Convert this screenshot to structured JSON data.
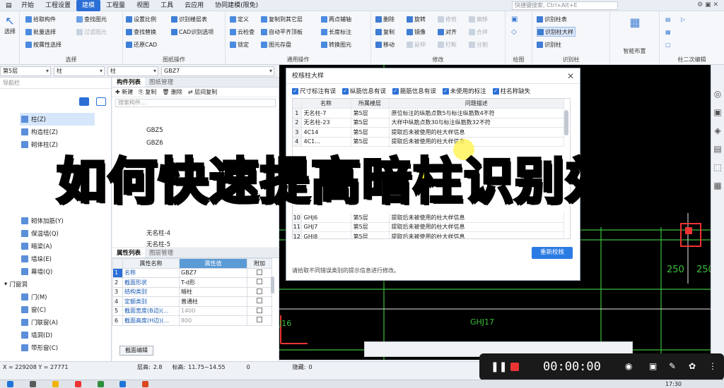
{
  "menubar": {
    "items": [
      "开始",
      "工程设置",
      "建模",
      "工程量",
      "视图",
      "工具",
      "云应用",
      "协同建模(限免)"
    ],
    "active_index": 2,
    "search_placeholder": "快捷键搜索, Ctrl+Alt+E"
  },
  "ribbon": {
    "select_label": "选择",
    "select_group": {
      "items": [
        "拾取构件",
        "批量选择",
        "按属性选择",
        "查找图元",
        "过滤图元"
      ],
      "label": "选择"
    },
    "drawing_group": {
      "items": [
        "设置比例",
        "识别楼层表",
        "查找替换",
        "CAD识别选项",
        "还原CAD"
      ],
      "label": "图纸操作"
    },
    "common_group": {
      "items": [
        "定义",
        "复制到其它层",
        "两点辅轴",
        "云检查",
        "自动平齐顶板",
        "长度标注",
        "锁定",
        "图元存盘",
        "转换图元"
      ],
      "label": "通用操作"
    },
    "modify_group": {
      "items": [
        "删除",
        "旋转",
        "修剪",
        "偏移",
        "复制",
        "镜像",
        "对齐",
        "合并",
        "移动",
        "延伸",
        "打断",
        "分割"
      ],
      "label": "修改"
    },
    "draw_label": "绘图",
    "recog_group": {
      "items": [
        "识别柱表",
        "识别柱大样",
        "识别柱"
      ],
      "label": "识别柱"
    },
    "smart_label": "智能布置",
    "second_label": "柱二次编辑"
  },
  "combos": {
    "floor": "第5层",
    "type": "柱",
    "subtype": "柱",
    "name": "GBZ7"
  },
  "nav": {
    "header": "导航栏",
    "items": [
      "柱(Z)",
      "构造柱(Z)",
      "砌体柱(Z)",
      "砌体加筋(Y)",
      "保温墙(Q)",
      "暗梁(A)",
      "墙垛(E)",
      "幕墙(Q)",
      "门窗洞",
      "门(M)",
      "窗(C)",
      "门联窗(A)",
      "墙洞(D)",
      "带形窗(C)"
    ]
  },
  "components": {
    "tabs": [
      "构件列表",
      "图纸管理"
    ],
    "toolbar": [
      "新建",
      "复制",
      "删除",
      "层间复制"
    ],
    "filter_placeholder": "搜索构件...",
    "items": [
      "GBZ5",
      "GBZ6",
      "无名柱-4",
      "无名柱-5"
    ]
  },
  "properties": {
    "tabs": [
      "属性列表",
      "图层管理"
    ],
    "headers": [
      "属性名称",
      "属性值",
      "附加"
    ],
    "rows": [
      {
        "no": "1",
        "name": "名称",
        "value": "GBZ7"
      },
      {
        "no": "2",
        "name": "截面形状",
        "value": "T-d形"
      },
      {
        "no": "3",
        "name": "结构类别",
        "value": "暗柱"
      },
      {
        "no": "4",
        "name": "定额类别",
        "value": "普通柱"
      },
      {
        "no": "5",
        "name": "截面宽度(B边)(...",
        "value": "1400"
      },
      {
        "no": "6",
        "name": "截面高度(H边)(...",
        "value": "800"
      }
    ],
    "edit_button": "截面编辑"
  },
  "dialog": {
    "title": "校核柱大样",
    "checks": [
      "尺寸标注有误",
      "纵筋信息有误",
      "箍筋信息有误",
      "未使用的标注",
      "柱名称缺失"
    ],
    "headers": [
      "名称",
      "所属楼层",
      "问题描述"
    ],
    "rows": [
      {
        "no": "1",
        "name": "无名柱-7",
        "floor": "第5层",
        "desc": "原位标注的纵筋点数5与标注纵筋数4不符"
      },
      {
        "no": "2",
        "name": "无名柱-23",
        "floor": "第5层",
        "desc": "大样中纵筋点数30与标注纵筋数32不符"
      },
      {
        "no": "3",
        "name": "4C14",
        "floor": "第5层",
        "desc": "提取后未被使用的柱大样信息"
      },
      {
        "no": "4",
        "name": "4C1...",
        "floor": "第5层",
        "desc": "提取后未被使用的柱大样信息"
      },
      {
        "no": "11",
        "name": "GHJ7",
        "floor": "第5层",
        "desc": "提取后未被使用的柱大样信息"
      },
      {
        "no": "12",
        "name": "GHJ8",
        "floor": "第5层",
        "desc": "提取后未被使用的柱大样信息"
      }
    ],
    "hidden_row": {
      "no": "10",
      "name": "GHJ6",
      "floor": "第5层",
      "desc": "提取后未被使用的柱大样信息"
    },
    "recheck_button": "重新校核",
    "hint": "请拾取不同错误类别的提示信息进行修改。"
  },
  "cad": {
    "label_ghj17": "GHJ17",
    "label_250a": "250",
    "label_250b": "250",
    "label_j16": "J16"
  },
  "overlay": {
    "title": "如何快速提高暗柱识别效率"
  },
  "status": {
    "coords": "X = 229208 Y = 27771",
    "floor_h_label": "层高:",
    "floor_h": "2.8",
    "elev_label": "标高:",
    "elev": "11.75~14.55",
    "zero": "0",
    "hidden_label": "隐藏:",
    "hidden": "0"
  },
  "recorder": {
    "time": "00:00:00"
  },
  "taskbar": {
    "clock": "17:30"
  }
}
